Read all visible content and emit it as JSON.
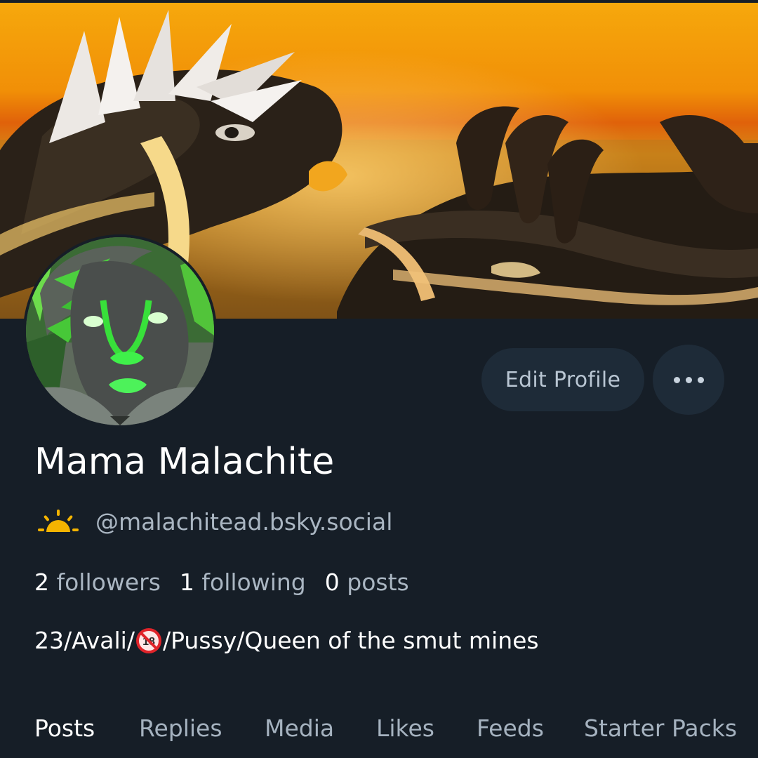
{
  "banner": {
    "description_icon": "banner-image"
  },
  "avatar": {
    "icon": "avatar-image"
  },
  "actions": {
    "edit_profile_label": "Edit Profile",
    "more_icon": "more-horizontal-icon"
  },
  "profile": {
    "display_name": "Mama Malachite",
    "status_icon": "sunrise-icon",
    "handle": "@malachitead.bsky.social"
  },
  "stats": {
    "followers_count": "2",
    "followers_label": "followers",
    "following_count": "1",
    "following_label": "following",
    "posts_count": "0",
    "posts_label": "posts"
  },
  "bio": {
    "before": "23/Avali/",
    "symbol_icon": "no-under-18-icon",
    "after": "/Pussy/Queen of the smut mines"
  },
  "tabs": [
    {
      "label": "Posts",
      "active": true
    },
    {
      "label": "Replies",
      "active": false
    },
    {
      "label": "Media",
      "active": false
    },
    {
      "label": "Likes",
      "active": false
    },
    {
      "label": "Feeds",
      "active": false
    },
    {
      "label": "Starter Packs",
      "active": false
    }
  ],
  "colors": {
    "background": "#161e27",
    "button_bg": "#1e2b38",
    "muted_text": "#aab6c2",
    "accent_sun": "#f5b400"
  }
}
